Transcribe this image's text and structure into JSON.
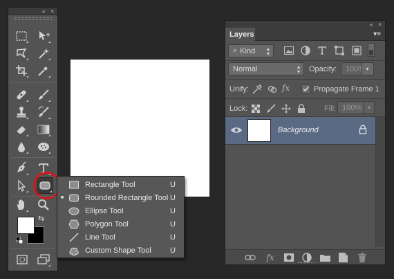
{
  "toolbox": {
    "collapse_glyph": "«",
    "close_glyph": "×",
    "tools": [
      {
        "name": "rectangular-marquee-tool",
        "icon": "marquee-icon"
      },
      {
        "name": "move-tool",
        "icon": "move-icon"
      },
      {
        "name": "lasso-tool",
        "icon": "lasso-icon"
      },
      {
        "name": "magic-wand-tool",
        "icon": "magic-wand-icon"
      },
      {
        "name": "crop-tool",
        "icon": "crop-icon"
      },
      {
        "name": "eyedropper-tool",
        "icon": "eyedropper-icon"
      },
      {
        "name": "healing-brush-tool",
        "icon": "bandage-icon"
      },
      {
        "name": "brush-tool",
        "icon": "brush-icon"
      },
      {
        "name": "clone-stamp-tool",
        "icon": "stamp-icon"
      },
      {
        "name": "history-brush-tool",
        "icon": "history-brush-icon"
      },
      {
        "name": "eraser-tool",
        "icon": "eraser-icon"
      },
      {
        "name": "gradient-tool",
        "icon": "gradient-icon"
      },
      {
        "name": "blur-tool",
        "icon": "drop-icon"
      },
      {
        "name": "sponge-tool",
        "icon": "sponge-icon"
      },
      {
        "name": "pen-tool",
        "icon": "pen-icon"
      },
      {
        "name": "type-tool",
        "icon": "type-icon"
      },
      {
        "name": "path-selection-tool",
        "icon": "arrow-icon"
      },
      {
        "name": "rounded-rectangle-tool",
        "icon": "rounded-rect-icon"
      },
      {
        "name": "hand-tool",
        "icon": "hand-icon"
      },
      {
        "name": "zoom-tool",
        "icon": "zoom-icon"
      }
    ],
    "foreground_color": "#ffffff",
    "background_color": "#000000",
    "swap_glyph": "⇆"
  },
  "flyout": {
    "items": [
      {
        "label": "Rectangle Tool",
        "shortcut": "U",
        "icon": "rectangle-icon",
        "selected": false
      },
      {
        "label": "Rounded Rectangle Tool",
        "shortcut": "U",
        "icon": "rounded-rect-icon",
        "selected": true
      },
      {
        "label": "Ellipse Tool",
        "shortcut": "U",
        "icon": "ellipse-icon",
        "selected": false
      },
      {
        "label": "Polygon Tool",
        "shortcut": "U",
        "icon": "polygon-icon",
        "selected": false
      },
      {
        "label": "Line Tool",
        "shortcut": "U",
        "icon": "line-icon",
        "selected": false
      },
      {
        "label": "Custom Shape Tool",
        "shortcut": "U",
        "icon": "custom-shape-icon",
        "selected": false
      }
    ],
    "bullet": "■"
  },
  "layers_panel": {
    "collapse_glyph": "«",
    "close_glyph": "×",
    "tab_label": "Layers",
    "menu_glyph": "▾≡",
    "filter_label": "Kind",
    "blend_mode": "Normal",
    "opacity_label": "Opacity:",
    "opacity_value": "100%",
    "unify_label": "Unify:",
    "propagate_label": "Propagate Frame 1",
    "propagate_checked": true,
    "lock_label": "Lock:",
    "fill_label": "Fill:",
    "fill_value": "100%",
    "layers": [
      {
        "name": "Background",
        "visible": true,
        "locked": true,
        "thumb_color": "#ffffff"
      }
    ],
    "selection_color": "#5b6a83"
  },
  "colors": {
    "app_background": "#282828",
    "panel": "#535353",
    "highlight_ring": "#d4161b"
  }
}
